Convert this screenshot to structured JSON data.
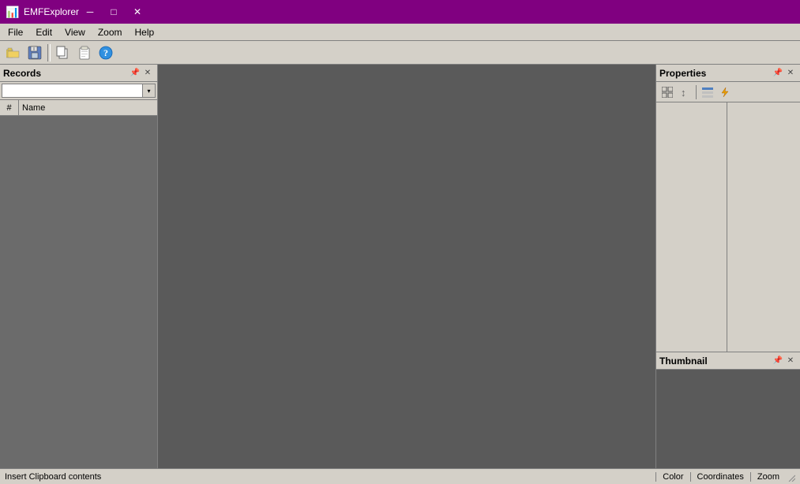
{
  "titlebar": {
    "icon": "📊",
    "title": "EMFExplorer",
    "minimize_label": "─",
    "maximize_label": "□",
    "close_label": "✕"
  },
  "menubar": {
    "items": [
      {
        "label": "File"
      },
      {
        "label": "Edit"
      },
      {
        "label": "View"
      },
      {
        "label": "Zoom"
      },
      {
        "label": "Help"
      }
    ]
  },
  "toolbar": {
    "buttons": [
      {
        "icon": "📂",
        "name": "open"
      },
      {
        "icon": "💾",
        "name": "save"
      },
      {
        "icon": "📋",
        "name": "paste-from"
      },
      {
        "icon": "📋",
        "name": "paste"
      },
      {
        "icon": "❓",
        "name": "help"
      }
    ]
  },
  "records_panel": {
    "title": "Records",
    "search_placeholder": "",
    "col_num": "#",
    "col_name": "Name"
  },
  "properties_panel": {
    "title": "Properties",
    "toolbar_buttons": [
      {
        "icon": "⊞",
        "name": "grid-view"
      },
      {
        "icon": "↕",
        "name": "sort"
      },
      {
        "icon": "▤",
        "name": "list-view"
      },
      {
        "icon": "⚡",
        "name": "lightning"
      }
    ]
  },
  "thumbnail_panel": {
    "title": "Thumbnail"
  },
  "statusbar": {
    "text": "Insert Clipboard contents",
    "sections": [
      {
        "label": "Color"
      },
      {
        "label": "Coordinates"
      },
      {
        "label": "Zoom"
      }
    ]
  }
}
